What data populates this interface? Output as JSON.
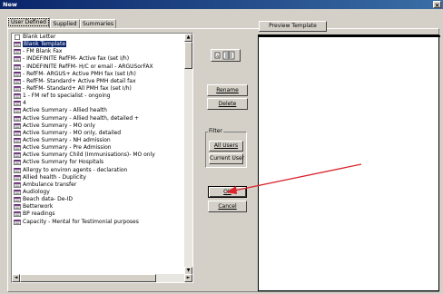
{
  "window": {
    "title": "New",
    "close_glyph": "×"
  },
  "tabs": [
    {
      "label": "User Defined",
      "active": true
    },
    {
      "label": "Supplied",
      "active": false
    },
    {
      "label": "Summaries",
      "active": false
    }
  ],
  "templates": [
    {
      "label": "Blank Letter",
      "icon": "blank-doc-icon",
      "selected": false
    },
    {
      "label": "Blank Template",
      "icon": "template-icon",
      "selected": true
    },
    {
      "label": "- FM Blank Fax",
      "icon": "template-icon",
      "selected": false
    },
    {
      "label": "- INDEFINITE RefFM- Active fax (set I/h)",
      "icon": "template-icon",
      "selected": false
    },
    {
      "label": "- INDEFINITE RefFM- H/C or email - ARGUSorFAX",
      "icon": "template-icon",
      "selected": false
    },
    {
      "label": "- RefFM- ARGUS+ Active PMH fax (set I/h)",
      "icon": "template-icon",
      "selected": false
    },
    {
      "label": "- RefFM- Standard+ Active PMH detail fax",
      "icon": "template-icon",
      "selected": false
    },
    {
      "label": "- RefFM- Standard+ All PMH fax (set I/h)",
      "icon": "template-icon",
      "selected": false
    },
    {
      "label": "1 - FM  ref to specialist - ongoing",
      "icon": "template-icon",
      "selected": false
    },
    {
      "label": "4",
      "icon": "template-icon",
      "selected": false
    },
    {
      "label": "Active Summary - Allied health",
      "icon": "template-icon",
      "selected": false
    },
    {
      "label": "Active Summary - Allied health, detailed +",
      "icon": "template-icon",
      "selected": false
    },
    {
      "label": "Active Summary - MO only",
      "icon": "template-icon",
      "selected": false
    },
    {
      "label": "Active Summary - MO only, detailed",
      "icon": "template-icon",
      "selected": false
    },
    {
      "label": "Active Summary - NH admission",
      "icon": "template-icon",
      "selected": false
    },
    {
      "label": "Active Summary - Pre Admission",
      "icon": "template-icon",
      "selected": false
    },
    {
      "label": "Active Summary Child (Immunisations)- MO only",
      "icon": "template-icon",
      "selected": false
    },
    {
      "label": "Active Summary for Hospitals",
      "icon": "template-icon",
      "selected": false
    },
    {
      "label": "Allergy to environ agents - declaration",
      "icon": "template-icon",
      "selected": false
    },
    {
      "label": "Allied health - Duplicity",
      "icon": "template-icon",
      "selected": false
    },
    {
      "label": "Ambulance transfer",
      "icon": "template-icon",
      "selected": false
    },
    {
      "label": "Audiology",
      "icon": "template-icon",
      "selected": false
    },
    {
      "label": "Beach data- De-ID",
      "icon": "template-icon",
      "selected": false
    },
    {
      "label": "Betterwork",
      "icon": "template-icon",
      "selected": false
    },
    {
      "label": "BP readings",
      "icon": "template-icon",
      "selected": false
    },
    {
      "label": "Capacity - Mental for Testimonial purposes",
      "icon": "template-icon",
      "selected": false
    }
  ],
  "buttons": {
    "rename_label": "Rename",
    "delete_label": "Delete",
    "all_users_label": "All Users",
    "current_user_label": "Current User",
    "ok_label": "OK",
    "cancel_label": "Cancel",
    "preview_label": "Preview Template"
  },
  "view_toggle": {
    "icons": [
      "large-icons-icon",
      "list-view-icon"
    ]
  },
  "filter": {
    "legend": "Filter"
  },
  "scroll_glyphs": {
    "up": "▲",
    "down": "▼",
    "left": "◄",
    "right": "►"
  },
  "colors": {
    "title_bar": "#0a246a",
    "selection": "#0a246a",
    "annotation_arrow": "#d9242b"
  }
}
